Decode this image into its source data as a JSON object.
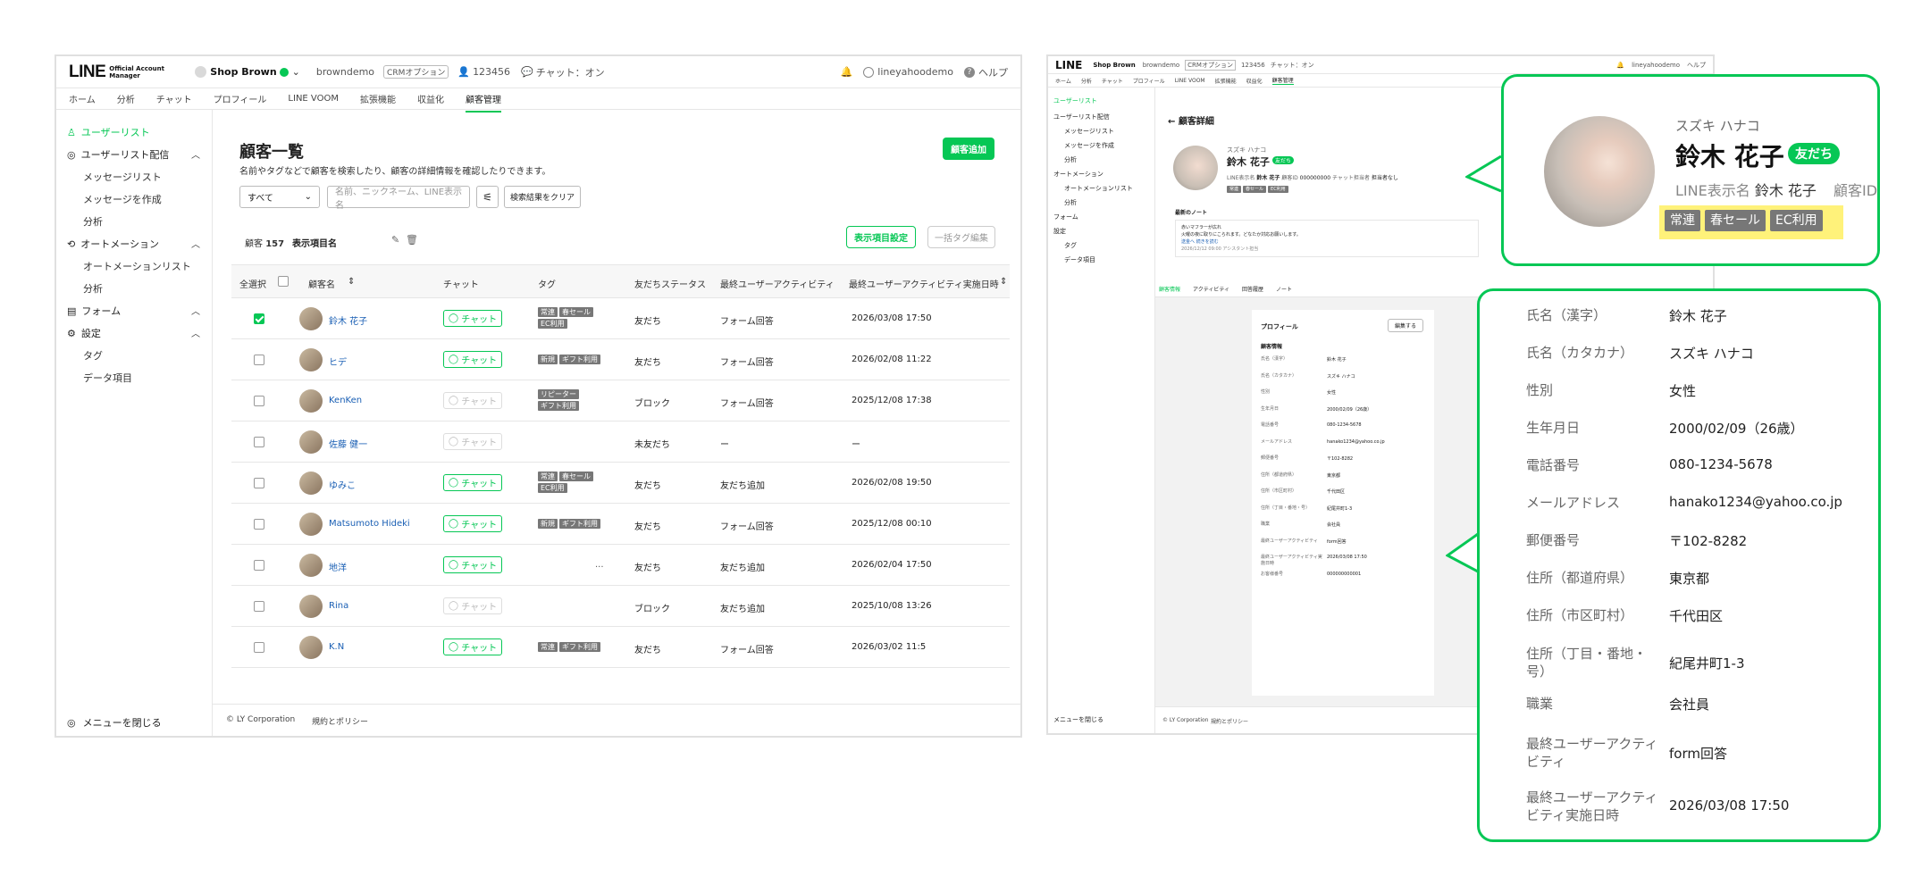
{
  "left": {
    "header": {
      "logo": "LINE",
      "logo_sub": "Official Account Manager",
      "account": "Shop Brown",
      "id": "browndemo",
      "crm": "CRMオプション",
      "followers": "123456",
      "chat_status": "チャット：オン",
      "user": "lineyahoodemo",
      "help": "ヘルプ"
    },
    "nav": [
      "ホーム",
      "分析",
      "チャット",
      "プロフィール",
      "LINE VOOM",
      "拡張機能",
      "収益化",
      "顧客管理"
    ],
    "sidebar": {
      "userlist": "ユーザーリスト",
      "delivery": "ユーザーリスト配信",
      "msglist": "メッセージリスト",
      "create": "メッセージを作成",
      "analysis": "分析",
      "automation": "オートメーション",
      "autolist": "オートメーションリスト",
      "analysis2": "分析",
      "form": "フォーム",
      "settings": "設定",
      "tag": "タグ",
      "data": "データ項目",
      "close": "メニューを閉じる"
    },
    "main": {
      "title": "顧客一覧",
      "desc": "名前やタグなどで顧客を検索したり、顧客の詳細情報を確認したりできます。",
      "add": "顧客追加",
      "filter": "すべて",
      "search_ph": "名前、ニックネーム、LINE表示名",
      "clear": "検索結果をクリア",
      "count_label": "顧客",
      "count": "157",
      "view_name": "表示項目名",
      "view_settings": "表示項目設定",
      "bulk_tag": "一括タグ編集"
    },
    "columns": [
      "全選択",
      "顧客名",
      "チャット",
      "タグ",
      "友だちステータス",
      "最終ユーザーアクティビティ",
      "最終ユーザーアクティビティ実施日時"
    ],
    "chat_label": "チャット",
    "rows": [
      {
        "name": "鈴木 花子",
        "checked": true,
        "chat": true,
        "tags": [
          "常連",
          "春セール",
          "EC利用"
        ],
        "status": "友だち",
        "activity": "フォーム回答",
        "date": "2026/03/08 17:50"
      },
      {
        "name": "ヒデ",
        "checked": false,
        "chat": true,
        "tags": [
          "新規",
          "ギフト利用"
        ],
        "status": "友だち",
        "activity": "フォーム回答",
        "date": "2026/02/08 11:22"
      },
      {
        "name": "KenKen",
        "checked": false,
        "chat": false,
        "tags": [
          "リピーター",
          "ギフト利用"
        ],
        "status": "ブロック",
        "activity": "フォーム回答",
        "date": "2025/12/08 17:38"
      },
      {
        "name": "佐藤 健一",
        "checked": false,
        "chat": false,
        "tags": [],
        "status": "未友だち",
        "activity": "ー",
        "date": "ー"
      },
      {
        "name": "ゆみこ",
        "checked": false,
        "chat": true,
        "tags": [
          "常連",
          "春セール",
          "EC利用"
        ],
        "status": "友だち",
        "activity": "友だち追加",
        "date": "2026/02/08 19:50"
      },
      {
        "name": "Matsumoto Hideki",
        "checked": false,
        "chat": true,
        "tags": [
          "新規",
          "ギフト利用"
        ],
        "status": "友だち",
        "activity": "フォーム回答",
        "date": "2025/12/08 00:10"
      },
      {
        "name": "地洋",
        "checked": false,
        "chat": true,
        "tags": [
          "..."
        ],
        "status": "友だち",
        "activity": "友だち追加",
        "date": "2026/02/04 17:50"
      },
      {
        "name": "Rina",
        "checked": false,
        "chat": false,
        "tags": [],
        "status": "ブロック",
        "activity": "友だち追加",
        "date": "2025/10/08 13:26"
      },
      {
        "name": "K.N",
        "checked": false,
        "chat": true,
        "tags": [
          "常連",
          "ギフト利用"
        ],
        "status": "友だち",
        "activity": "フォーム回答",
        "date": "2026/03/02 11:5"
      }
    ],
    "footer": {
      "corp": "© LY Corporation",
      "policy": "規約とポリシー"
    }
  },
  "right": {
    "back_title": "顧客詳細",
    "kana": "スズキ ハナコ",
    "name": "鈴木 花子",
    "badge": "友だち",
    "line_name_label": "LINE表示名",
    "line_name": "鈴木 花子",
    "cust_id_label": "顧客ID",
    "cust_id": "000000000",
    "chat_label": "チャット担当者",
    "chat_person": "担当者なし",
    "tags": [
      "常連",
      "春セール",
      "EC利用"
    ],
    "note_title": "最新のノート",
    "note_lines": [
      "赤いマフラーが広れ",
      "火曜の夜に取りにこられます。どなたか対応お願いします。",
      "送金へ 続きを読む"
    ],
    "note_meta": "2026/12/12 09:00 アシスタント担当",
    "tabs": [
      "顧客情報",
      "アクティビティ",
      "回答履歴",
      "ノート"
    ],
    "profile_title": "プロフィール",
    "edit": "編集する",
    "section": "顧客情報",
    "fields": [
      {
        "k": "氏名（漢字）",
        "v": "鈴木 花子"
      },
      {
        "k": "氏名（カタカナ）",
        "v": "スズキ ハナコ"
      },
      {
        "k": "性別",
        "v": "女性"
      },
      {
        "k": "生年月日",
        "v": "2000/02/09（26歳）"
      },
      {
        "k": "電話番号",
        "v": "080-1234-5678"
      },
      {
        "k": "メールアドレス",
        "v": "hanako1234@yahoo.co.jp"
      },
      {
        "k": "郵便番号",
        "v": "〒102-8282"
      },
      {
        "k": "住所（都道府県）",
        "v": "東京都"
      },
      {
        "k": "住所（市区町村）",
        "v": "千代田区"
      },
      {
        "k": "住所（丁目・番地・号）",
        "v": "紀尾井町1-3"
      },
      {
        "k": "職業",
        "v": "会社員"
      },
      {
        "k": "最終ユーザーアクティビティ",
        "v": "form回答"
      },
      {
        "k": "最終ユーザーアクティビティ実施日時",
        "v": "2026/03/08 17:50"
      },
      {
        "k": "お客様番号",
        "v": "000000000001"
      }
    ],
    "sidebar": [
      "ユーザーリスト",
      "ユーザーリスト配信",
      "メッセージリスト",
      "メッセージを作成",
      "分析",
      "オートメーション",
      "オートメーションリスト",
      "分析",
      "フォーム",
      "設定",
      "タグ",
      "データ項目"
    ],
    "close": "メニューを閉じる"
  }
}
